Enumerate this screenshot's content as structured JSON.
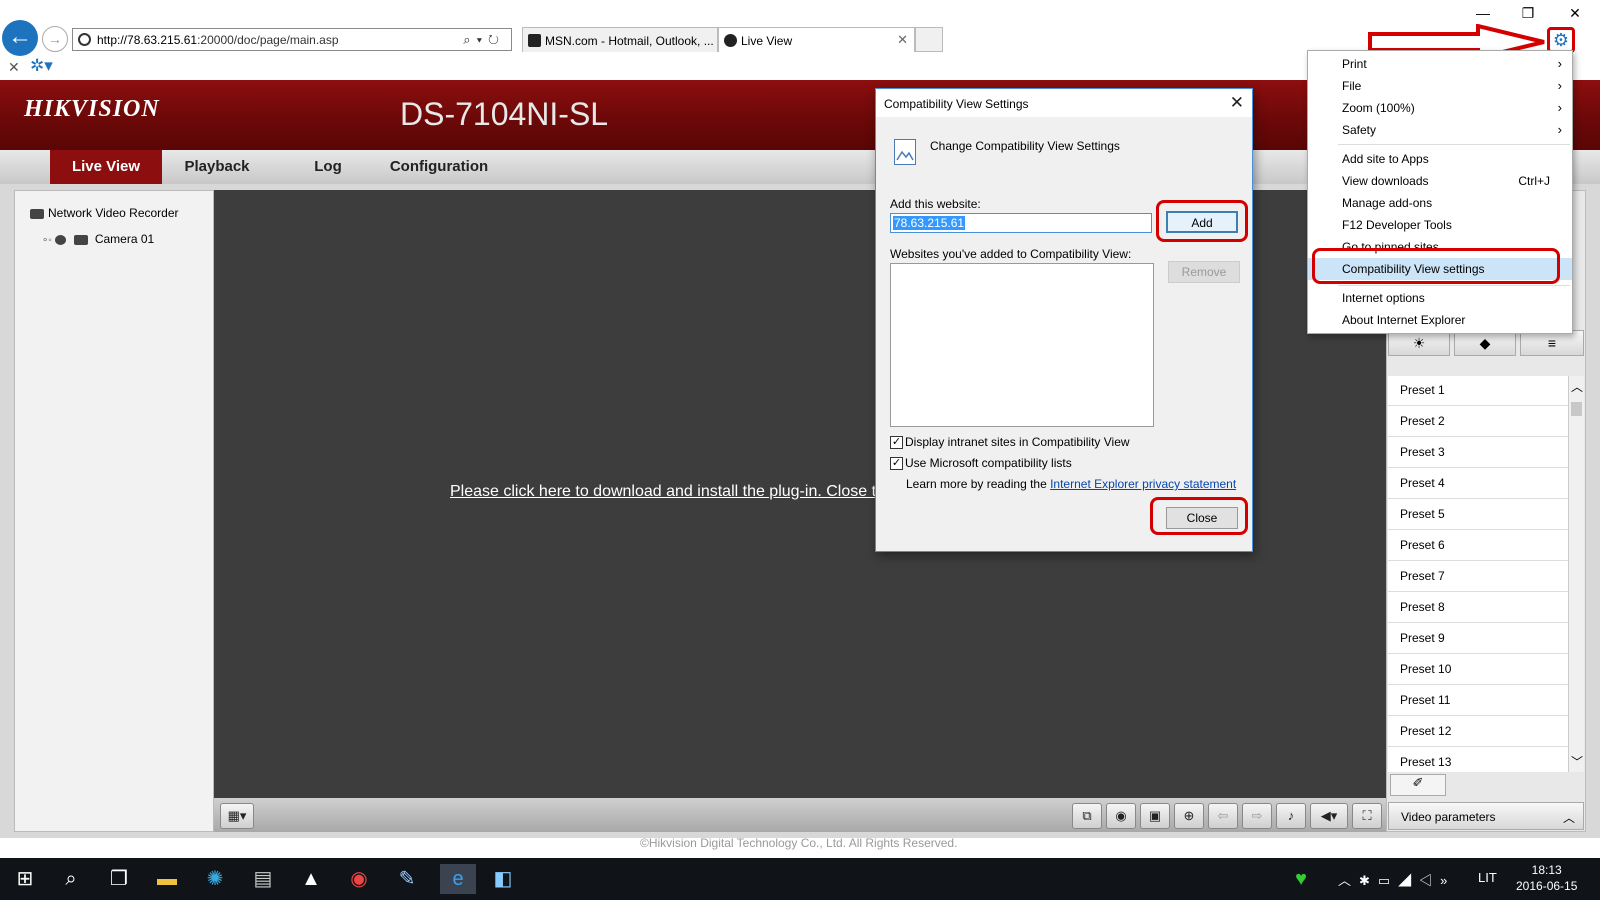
{
  "browser": {
    "url_host": "http://78.63.215.61",
    "url_path": ":20000/doc/page/main.asp",
    "tabs": [
      {
        "label": "MSN.com - Hotmail, Outlook, ..."
      },
      {
        "label": "Live View"
      }
    ],
    "window_controls": {
      "minimize": "—",
      "restore": "❐",
      "close": "✕"
    }
  },
  "hikvision": {
    "logo": "HIKVISION",
    "model": "DS-7104NI-SL",
    "nav": [
      "Live View",
      "Playback",
      "Log",
      "Configuration"
    ],
    "tree": {
      "root": "Network Video Recorder",
      "camera": "Camera 01"
    },
    "plugin_message": "Please click here to download and install the plug-in. Close t",
    "presets": [
      "Preset 1",
      "Preset 2",
      "Preset 3",
      "Preset 4",
      "Preset 5",
      "Preset 6",
      "Preset 7",
      "Preset 8",
      "Preset 9",
      "Preset 10",
      "Preset 11",
      "Preset 12",
      "Preset 13"
    ],
    "video_parameters": "Video parameters",
    "copyright": "©Hikvision Digital Technology Co., Ltd. All Rights Reserved."
  },
  "dialog": {
    "title": "Compatibility View Settings",
    "heading": "Change Compatibility View Settings",
    "add_label": "Add this website:",
    "add_value": "78.63.215.61",
    "add_button": "Add",
    "list_label": "Websites you've added to Compatibility View:",
    "remove_button": "Remove",
    "checkbox_intranet": "Display intranet sites in Compatibility View",
    "checkbox_ms_lists": "Use Microsoft compatibility lists",
    "learn_prefix": "Learn more by reading the ",
    "learn_link": "Internet Explorer privacy statement",
    "close_button": "Close"
  },
  "ie_menu": {
    "group1": [
      {
        "label": "Print",
        "submenu": true
      },
      {
        "label": "File",
        "submenu": true
      },
      {
        "label": "Zoom (100%)",
        "submenu": true
      },
      {
        "label": "Safety",
        "submenu": true
      }
    ],
    "group2": [
      {
        "label": "Add site to Apps",
        "shortcut": ""
      },
      {
        "label": "View downloads",
        "shortcut": "Ctrl+J"
      },
      {
        "label": "Manage add-ons",
        "shortcut": ""
      },
      {
        "label": "F12 Developer Tools",
        "shortcut": ""
      },
      {
        "label": "Go to pinned sites",
        "shortcut": ""
      },
      {
        "label": "Compatibility View settings",
        "shortcut": "",
        "highlighted": true
      }
    ],
    "group3": [
      {
        "label": "Internet options"
      },
      {
        "label": "About Internet Explorer"
      }
    ]
  },
  "taskbar": {
    "lang": "LIT",
    "time": "18:13",
    "date": "2016-06-15"
  },
  "colors": {
    "hik_red": "#8d0e0e",
    "annotation_red": "#d40000",
    "ie_blue": "#1e73be"
  }
}
